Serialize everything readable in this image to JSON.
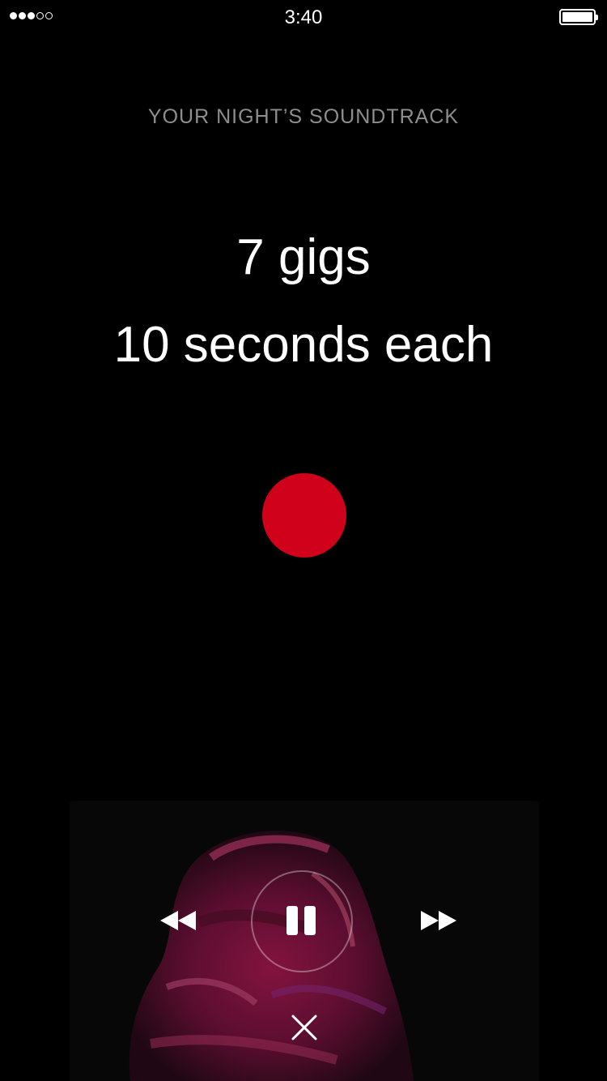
{
  "status_bar": {
    "time": "3:40",
    "signal_bars_filled": 3,
    "signal_bars_total": 5,
    "battery_level": 1.0
  },
  "header": {
    "eyebrow": "YOUR NIGHT’S SOUNDTRACK"
  },
  "stats": {
    "line1": "7 gigs",
    "line2": "10 seconds each"
  },
  "colors": {
    "background": "#000000",
    "record": "#d0021b",
    "eyebrow_text": "#8e8e8e",
    "artwork_accent": "#c2185b"
  },
  "player": {
    "icons": {
      "rewind": "rewind-icon",
      "pause": "pause-icon",
      "forward": "fast-forward-icon",
      "close": "close-icon"
    }
  }
}
